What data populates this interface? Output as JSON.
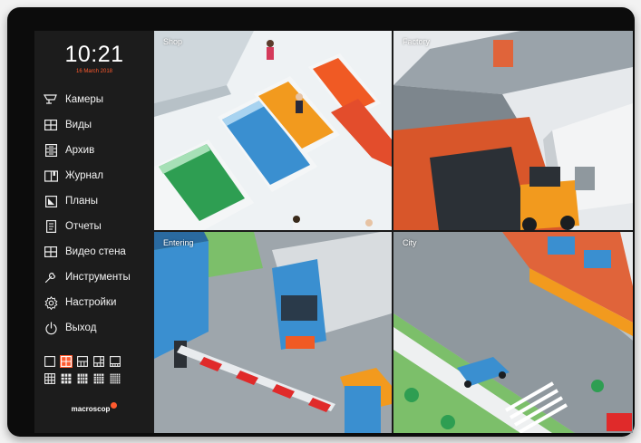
{
  "clock": {
    "time": "10:21",
    "date": "16 March 2018"
  },
  "menu": [
    {
      "label": "Камеры",
      "icon": "camera-icon"
    },
    {
      "label": "Виды",
      "icon": "grid-view-icon"
    },
    {
      "label": "Архив",
      "icon": "archive-icon"
    },
    {
      "label": "Журнал",
      "icon": "journal-icon"
    },
    {
      "label": "Планы",
      "icon": "plans-icon"
    },
    {
      "label": "Отчеты",
      "icon": "reports-icon"
    },
    {
      "label": "Видео стена",
      "icon": "video-wall-icon"
    },
    {
      "label": "Инструменты",
      "icon": "wrench-icon"
    },
    {
      "label": "Настройки",
      "icon": "gear-icon"
    },
    {
      "label": "Выход",
      "icon": "power-icon"
    }
  ],
  "layouts": {
    "selected": "2x2",
    "options": [
      "1x1",
      "2x2",
      "1+3",
      "1+5",
      "1+7",
      "3x3",
      "1+8",
      "1+12",
      "4x4",
      "5x5"
    ]
  },
  "brand": {
    "name": "macroscop"
  },
  "cameras": [
    {
      "name": "Shop"
    },
    {
      "name": "Factory"
    },
    {
      "name": "Entering"
    },
    {
      "name": "City"
    }
  ],
  "colors": {
    "accent": "#ff5a2e",
    "sidebar": "#1c1c1c",
    "bezel": "#0c0c0c"
  }
}
